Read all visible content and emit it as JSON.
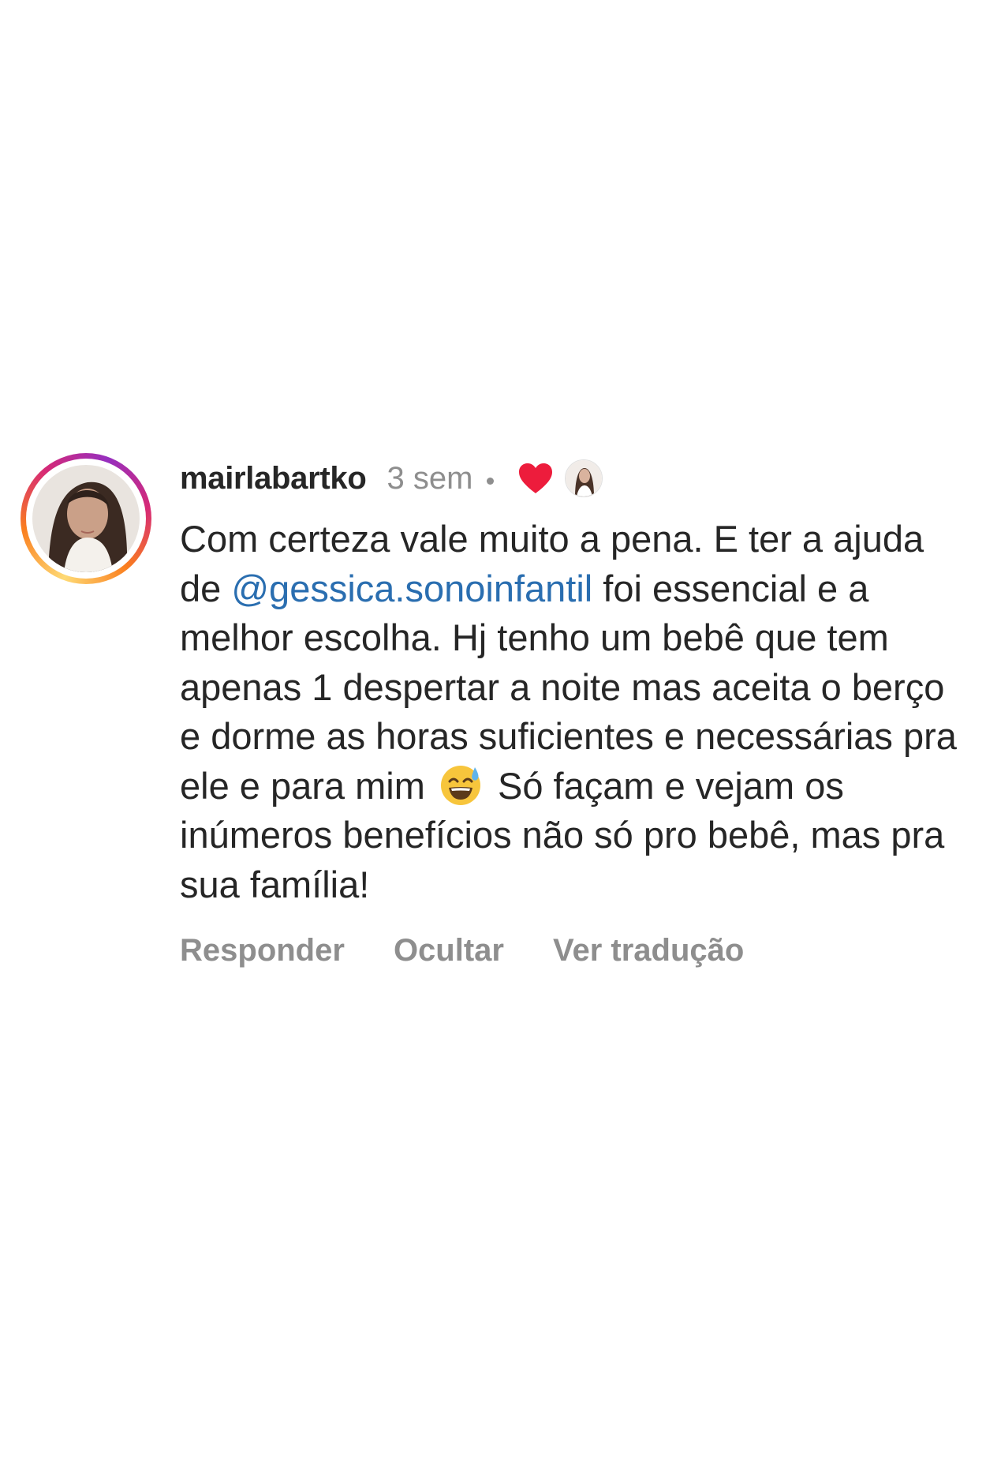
{
  "comment": {
    "username": "mairlabartko",
    "time": "3 sem",
    "text_part1": "Com certeza vale muito a pena. E ter a ajuda de ",
    "mention": "@gessica.sonoinfantil",
    "text_part2": " foi essencial e a melhor escolha. Hj tenho um bebê que tem apenas 1 despertar a noite mas aceita o berço e dorme as horas suficientes e necessárias pra ele e para mim",
    "text_part3": " Só façam e vejam os inúmeros benefícios não só pro bebê, mas pra sua família!",
    "emoji": "sweat-smile-emoji",
    "liked_by_author": true
  },
  "actions": {
    "reply_label": "Responder",
    "hide_label": "Ocultar",
    "translate_label": "Ver tradução"
  },
  "colors": {
    "mention": "#2a6eb0",
    "heart": "#ed1c3c",
    "muted": "#8e8e8e",
    "text": "#262626"
  }
}
